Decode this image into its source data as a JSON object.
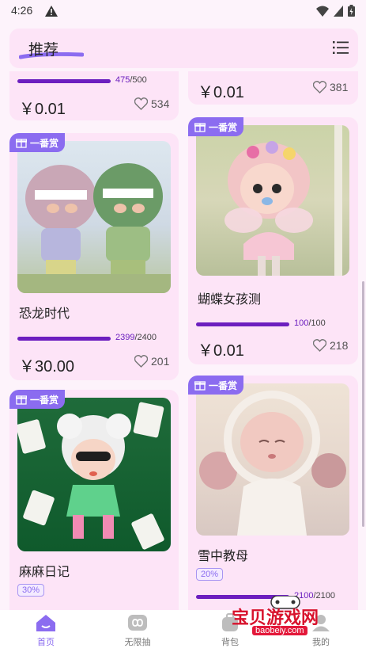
{
  "status_bar": {
    "time": "4:26"
  },
  "header": {
    "title": "推荐"
  },
  "colors": {
    "accent": "#8b6cf0",
    "progress": "#6c1fbf",
    "card_bg": "#fde4f7",
    "page_bg": "#fdf3fb"
  },
  "cards": [
    {
      "progress_sold": "475",
      "progress_total": "/500",
      "progress_fraction": 0.95,
      "price": "￥0.01",
      "likes": "534"
    },
    {
      "price": "￥0.01",
      "likes": "381"
    },
    {
      "badge": "一番赏",
      "title": "恐龙时代",
      "progress_sold": "2399",
      "progress_total": "/2400",
      "progress_fraction": 0.9996,
      "price": "￥30.00",
      "likes": "201"
    },
    {
      "badge": "一番赏",
      "title": "蝴蝶女孩测",
      "progress_sold": "100",
      "progress_total": "/100",
      "progress_fraction": 1.0,
      "price": "￥0.01",
      "likes": "218"
    },
    {
      "badge": "一番赏",
      "title": "麻麻日记",
      "tag": "30%"
    },
    {
      "badge": "一番赏",
      "title": "雪中教母",
      "tag": "20%",
      "progress_sold": "2100",
      "progress_total": "/2100"
    }
  ],
  "tabbar": [
    {
      "label": "首页",
      "icon": "home-icon",
      "active": true
    },
    {
      "label": "无限抽",
      "icon": "infinity-icon",
      "active": false
    },
    {
      "label": "背包",
      "icon": "backpack-icon",
      "active": false
    },
    {
      "label": "我的",
      "icon": "profile-icon",
      "active": false
    }
  ],
  "watermark": {
    "text": "宝贝游戏网",
    "url": "baobeiy.com"
  }
}
